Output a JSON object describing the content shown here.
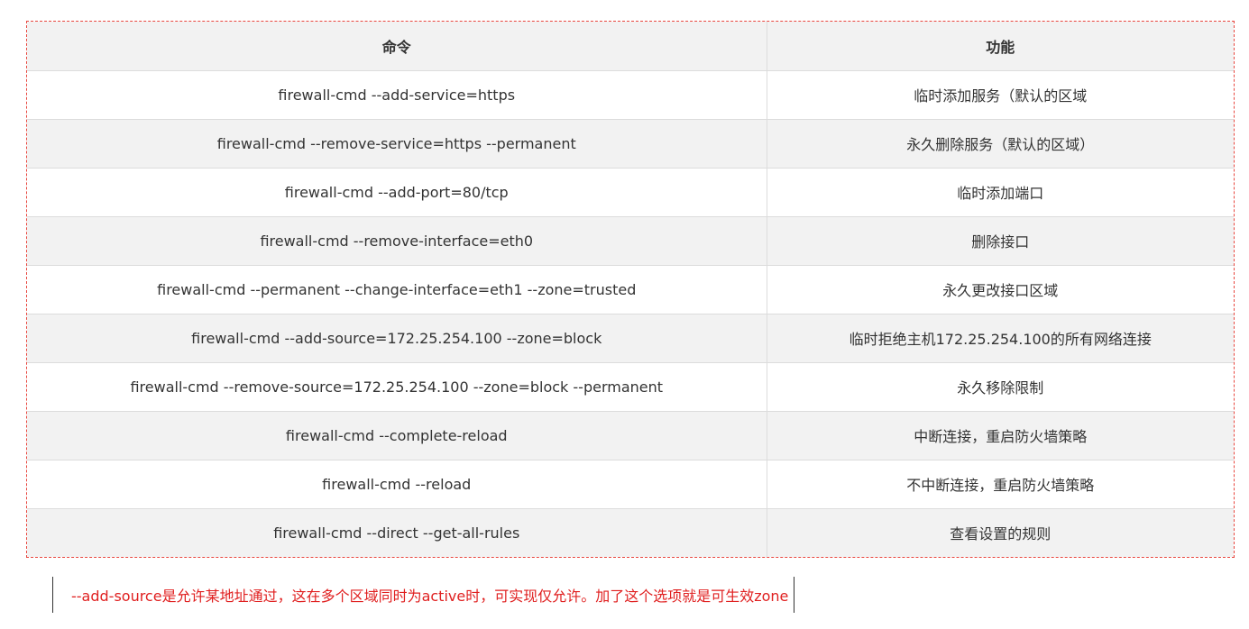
{
  "table": {
    "headers": [
      "命令",
      "功能"
    ],
    "rows": [
      {
        "command": "firewall-cmd --add-service=https",
        "function": "临时添加服务（默认的区域"
      },
      {
        "command": "firewall-cmd --remove-service=https --permanent",
        "function": "永久删除服务（默认的区域）"
      },
      {
        "command": "firewall-cmd --add-port=80/tcp",
        "function": "临时添加端口"
      },
      {
        "command": "firewall-cmd --remove-interface=eth0",
        "function": "删除接口"
      },
      {
        "command": "firewall-cmd --permanent --change-interface=eth1 --zone=trusted",
        "function": "永久更改接口区域"
      },
      {
        "command": "firewall-cmd --add-source=172.25.254.100 --zone=block",
        "function": "临时拒绝主机172.25.254.100的所有网络连接"
      },
      {
        "command": "firewall-cmd --remove-source=172.25.254.100 --zone=block --permanent",
        "function": "永久移除限制"
      },
      {
        "command": "firewall-cmd --complete-reload",
        "function": "中断连接，重启防火墙策略"
      },
      {
        "command": "firewall-cmd --reload",
        "function": "不中断连接，重启防火墙策略"
      },
      {
        "command": "firewall-cmd --direct --get-all-rules",
        "function": "查看设置的规则"
      }
    ]
  },
  "note": {
    "text": "--add-source是允许某地址通过，这在多个区域同时为active时，可实现仅允许。加了这个选项就是可生效zone"
  },
  "colors": {
    "frame_border": "#e8473f",
    "note_text": "#e02020",
    "stripe": "#f2f2f2"
  }
}
